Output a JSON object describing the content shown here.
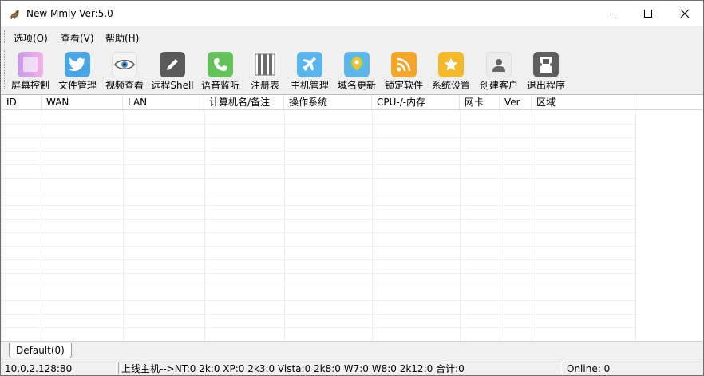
{
  "window": {
    "title": "New Mmly Ver:5.0"
  },
  "menu": [
    {
      "label": "选项(O)"
    },
    {
      "label": "查看(V)"
    },
    {
      "label": "帮助(H)"
    }
  ],
  "toolbar": [
    {
      "label": "屏幕控制",
      "icon": "screen-control-icon",
      "color": "#e8a2e6"
    },
    {
      "label": "文件管理",
      "icon": "twitter-bird-icon",
      "color": "#4aa5e6"
    },
    {
      "label": "视频查看",
      "icon": "eye-icon",
      "color": "#f0f0f0"
    },
    {
      "label": "远程Shell",
      "icon": "pencil-icon",
      "color": "#5a5a5a"
    },
    {
      "label": "语音监听",
      "icon": "phone-icon",
      "color": "#63c25a"
    },
    {
      "label": "注册表",
      "icon": "piano-keys-icon",
      "color": "#6b6b6b"
    },
    {
      "label": "主机管理",
      "icon": "airplane-icon",
      "color": "#58b6ea"
    },
    {
      "label": "域名更新",
      "icon": "map-pin-icon",
      "color": "#5cb6e9"
    },
    {
      "label": "锁定软件",
      "icon": "rss-icon",
      "color": "#f3a629"
    },
    {
      "label": "系统设置",
      "icon": "star-icon",
      "color": "#f3b929"
    },
    {
      "label": "创建客户",
      "icon": "user-icon",
      "color": "#e8e8e8"
    },
    {
      "label": "退出程序",
      "icon": "exit-ticket-icon",
      "color": "#5e5e5e"
    }
  ],
  "columns": [
    {
      "label": "ID"
    },
    {
      "label": "WAN"
    },
    {
      "label": "LAN"
    },
    {
      "label": "计算机名/备注"
    },
    {
      "label": "操作系统"
    },
    {
      "label": "CPU-/-内存"
    },
    {
      "label": "网卡"
    },
    {
      "label": "Ver"
    },
    {
      "label": "区域"
    }
  ],
  "tabs": [
    {
      "label": "Default(0)"
    }
  ],
  "status": {
    "address": "10.0.2.128:80",
    "summary": "上线主机-->NT:0  2k:0  XP:0  2k3:0  Vista:0  2k8:0  W7:0  W8:0  2k12:0  合计:0",
    "online": "Online: 0"
  }
}
